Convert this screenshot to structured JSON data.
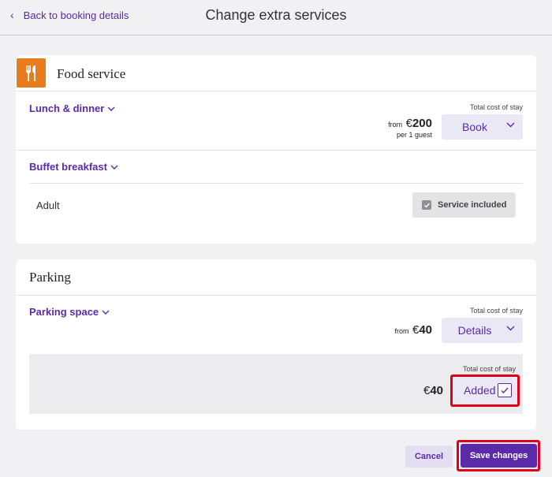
{
  "header": {
    "back_label": "Back to booking details",
    "title": "Change extra services"
  },
  "food": {
    "title": "Food service",
    "icon": "fork-knife-icon",
    "icon_color": "#ea7a1e",
    "lunch": {
      "name": "Lunch & dinner",
      "total_label": "Total cost of stay",
      "from": "from",
      "currency": "€",
      "amount": "200",
      "per": "per 1 guest",
      "button": "Book"
    },
    "breakfast": {
      "name": "Buffet breakfast",
      "guest_type": "Adult",
      "included_label": "Service included"
    }
  },
  "parking": {
    "title": "Parking",
    "space": {
      "name": "Parking space",
      "total_label": "Total cost of stay",
      "from": "from",
      "currency": "€",
      "amount": "40",
      "button": "Details"
    },
    "added": {
      "total_label": "Total cost of stay",
      "currency": "€",
      "amount": "40",
      "button": "Added"
    }
  },
  "footer": {
    "cancel_label": "Cancel",
    "save_label": "Save changes"
  },
  "colors": {
    "accent": "#5a2aa8",
    "highlight": "#e0001b"
  }
}
